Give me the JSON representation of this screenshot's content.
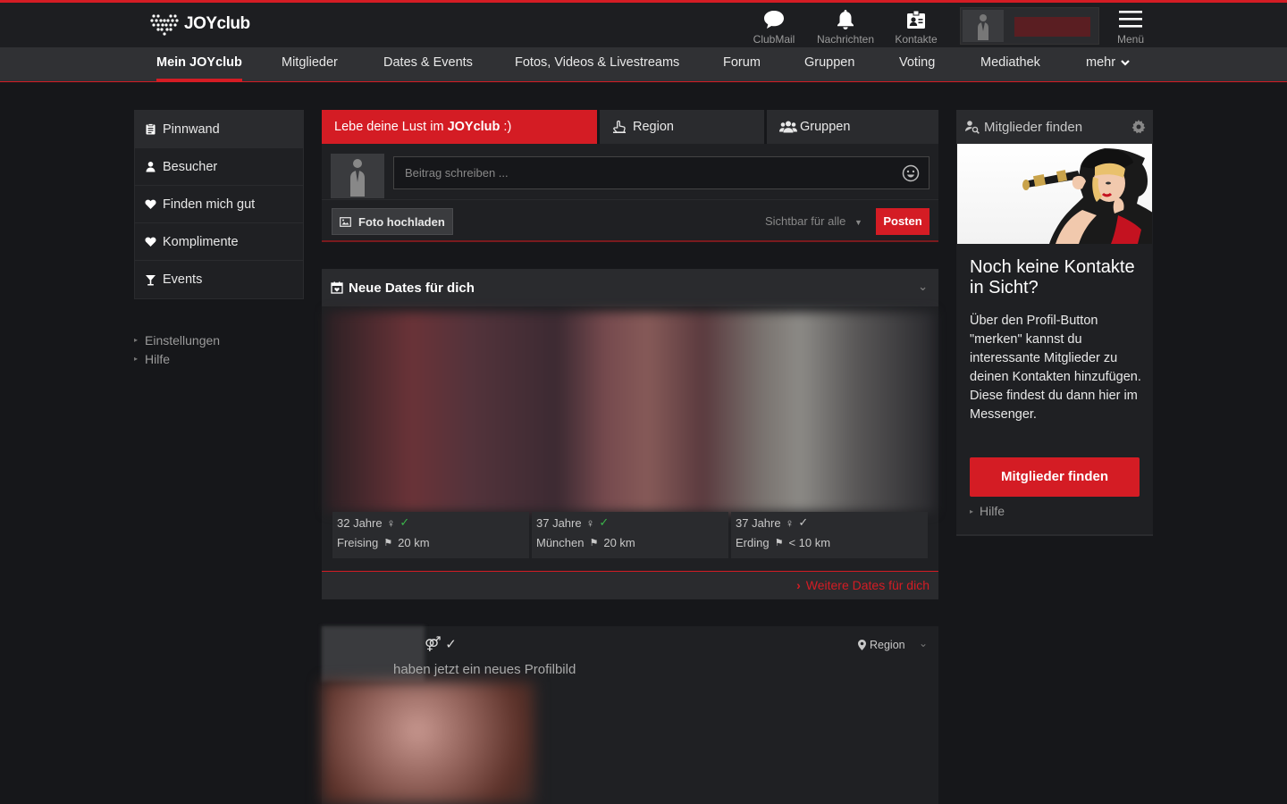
{
  "brand": {
    "name": "JOYclub"
  },
  "topbar": {
    "clubmail": "ClubMail",
    "nachrichten": "Nachrichten",
    "kontakte": "Kontakte",
    "menu": "Menü"
  },
  "nav": [
    "Mein JOYclub",
    "Mitglieder",
    "Dates & Events",
    "Fotos, Videos & Livestreams",
    "Forum",
    "Gruppen",
    "Voting",
    "Mediathek",
    "mehr"
  ],
  "sidebar": {
    "items": [
      "Pinnwand",
      "Besucher",
      "Finden mich gut",
      "Komplimente",
      "Events"
    ],
    "links": [
      "Einstellungen",
      "Hilfe"
    ]
  },
  "tabs": {
    "main_prefix": "Lebe deine Lust im ",
    "main_brand": "JOYclub",
    "main_suffix": " :)",
    "region": "Region",
    "gruppen": "Gruppen"
  },
  "composer": {
    "placeholder": "Beitrag schreiben ...",
    "photo_button": "Foto hochladen",
    "visibility": "Sichtbar für alle",
    "post_button": "Posten"
  },
  "dates": {
    "title": "Neue Dates für dich",
    "cards": [
      {
        "age": "32 Jahre",
        "city": "Freising",
        "distance": "20 km",
        "verified": true
      },
      {
        "age": "37 Jahre",
        "city": "München",
        "distance": "20 km",
        "verified": true
      },
      {
        "age": "37 Jahre",
        "city": "Erding",
        "distance": "< 10 km",
        "verified": false
      }
    ],
    "more": "Weitere Dates für dich"
  },
  "feed": {
    "text": "haben jetzt ein neues Profilbild",
    "region": "Region"
  },
  "right_panel": {
    "title": "Mitglieder finden",
    "heading": "Noch keine Kontakte in Sicht?",
    "text": "Über den Profil-Button \"merken\" kannst du interessante Mitglieder zu deinen Kontakten hinzufügen. Diese findest du dann hier im Messenger.",
    "button": "Mitglieder finden",
    "help": "Hilfe"
  },
  "colors": {
    "accent": "#d41c24",
    "background": "#16171a",
    "panel": "#1f2023",
    "verified": "#3bb54a"
  }
}
